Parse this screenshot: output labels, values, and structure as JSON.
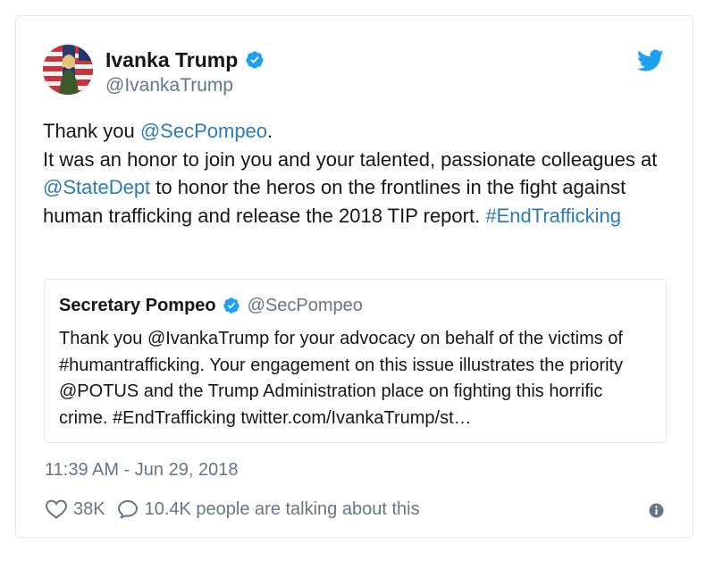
{
  "author": {
    "display_name": "Ivanka Trump",
    "screen_name": "@IvankaTrump"
  },
  "tweet": {
    "line1_prefix": "Thank you ",
    "line1_mention": "@SecPompeo",
    "line1_suffix": ".",
    "body_part1": "It was an honor to join you and your talented, passionate colleagues at ",
    "body_mention": "@StateDept",
    "body_part2": " to honor the heros on the frontlines in the fight against human trafficking and release the 2018 TIP report. ",
    "hashtag": "#EndTrafficking"
  },
  "quoted": {
    "display_name": "Secretary Pompeo",
    "screen_name": "@SecPompeo",
    "text": "Thank you @IvankaTrump for your advocacy on behalf of the victims of #humantrafficking. Your engagement on this issue illustrates the priority @POTUS and the Trump Administration place on fighting this horrific crime. #EndTrafficking twitter.com/IvankaTrump/st…"
  },
  "timestamp": "11:39 AM - Jun 29, 2018",
  "actions": {
    "like_count": "38K",
    "talking_text": "10.4K people are talking about this"
  },
  "colors": {
    "link": "#2b7bb9",
    "twitter_blue": "#1da1f2",
    "secondary_text": "#657786",
    "border": "#e1e8ed"
  }
}
